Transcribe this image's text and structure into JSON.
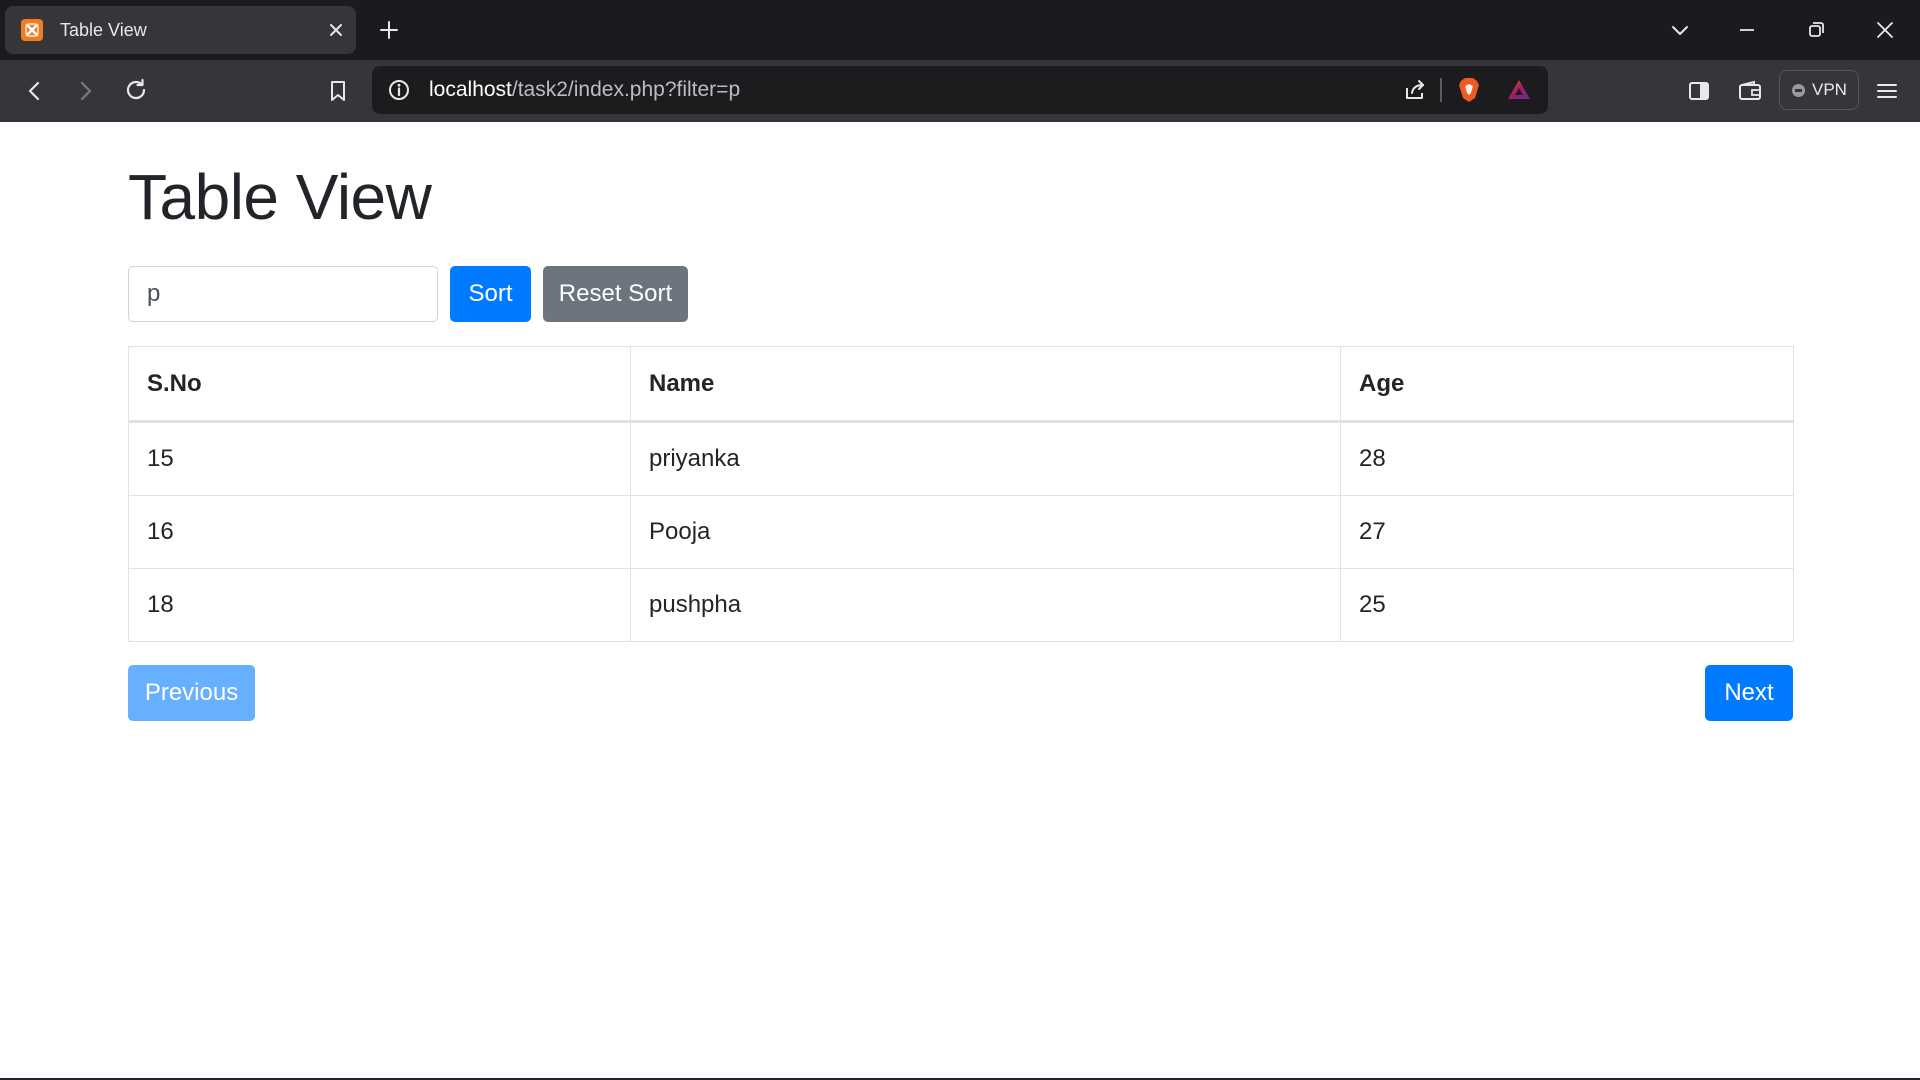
{
  "browser": {
    "tab": {
      "title": "Table View"
    },
    "address_bar": {
      "host": "localhost",
      "path": "/task2/index.php?filter=p"
    },
    "vpn_label": "VPN"
  },
  "page": {
    "title": "Table View",
    "filter": {
      "value": "p"
    },
    "buttons": {
      "sort": "Sort",
      "reset_sort": "Reset Sort"
    },
    "table": {
      "headers": [
        "S.No",
        "Name",
        "Age"
      ],
      "rows": [
        [
          "15",
          "priyanka",
          "28"
        ],
        [
          "16",
          "Pooja",
          "27"
        ],
        [
          "18",
          "pushpha",
          "25"
        ]
      ]
    },
    "pagination": {
      "previous": "Previous",
      "next": "Next"
    }
  },
  "colors": {
    "primary": "#007bff",
    "primary_disabled": "#66b0ff",
    "secondary": "#6c757d",
    "brave_accent": "#f15a22"
  },
  "icons": [
    "xampp-favicon",
    "close-icon",
    "plus-icon",
    "chevron-down-icon",
    "minimize-icon",
    "restore-icon",
    "back-icon",
    "forward-icon",
    "reload-icon",
    "bookmark-icon",
    "info-icon",
    "share-icon",
    "brave-shields-icon",
    "brave-rewards-icon",
    "sidebar-icon",
    "wallet-icon",
    "menu-icon"
  ]
}
